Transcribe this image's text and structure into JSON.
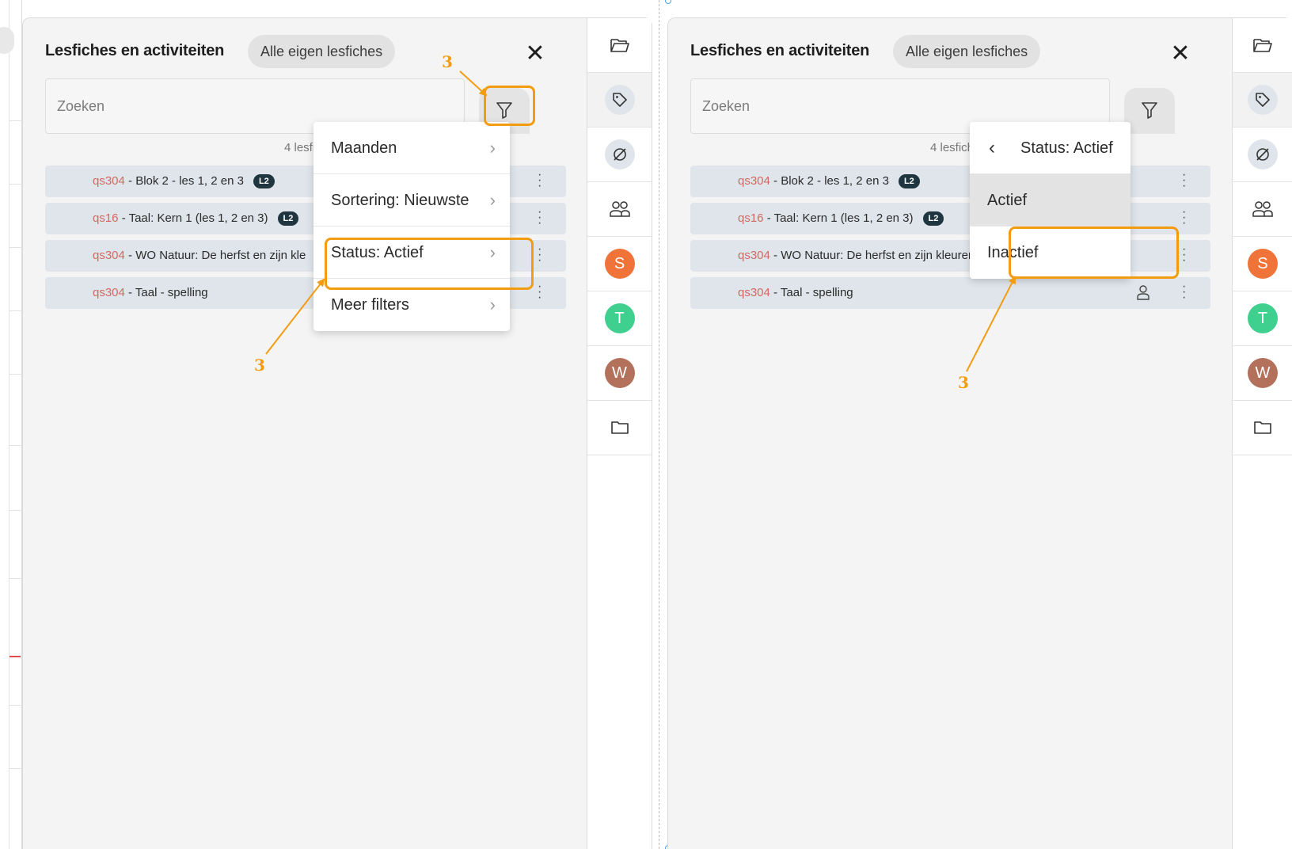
{
  "left": {
    "panel": {
      "title": "Lesfiches en activiteiten",
      "chip": "Alle eigen lesfiches",
      "search_placeholder": "Zoeken",
      "count": "4 lesfic"
    },
    "rows": [
      {
        "code": "qs304",
        "title": " - Blok 2 - les 1, 2 en 3",
        "badge": "L2"
      },
      {
        "code": "qs16",
        "title": " - Taal: Kern 1 (les 1, 2 en 3)",
        "badge": "L2"
      },
      {
        "code": "qs304",
        "title": " - WO Natuur: De herfst en zijn kle",
        "badge": ""
      },
      {
        "code": "qs304",
        "title": " - Taal - spelling",
        "badge": ""
      }
    ],
    "menu": [
      {
        "label": "Maanden"
      },
      {
        "label": "Sortering: Nieuwste"
      },
      {
        "label": "Status: Actief"
      },
      {
        "label": "Meer filters"
      }
    ],
    "annotations": [
      "3",
      "3"
    ]
  },
  "right": {
    "panel": {
      "title": "Lesfiches en activiteiten",
      "chip": "Alle eigen lesfiches",
      "search_placeholder": "Zoeken",
      "count": "4 lesfiches"
    },
    "rows": [
      {
        "code": "qs304",
        "title": " - Blok 2 - les 1, 2 en 3",
        "badge": "L2"
      },
      {
        "code": "qs16",
        "title": " - Taal: Kern 1 (les 1, 2 en 3)",
        "badge": "L2"
      },
      {
        "code": "qs304",
        "title": " - WO Natuur: De herfst en zijn kleuren d",
        "badge": ""
      },
      {
        "code": "qs304",
        "title": " - Taal - spelling",
        "badge": ""
      }
    ],
    "submenu": {
      "header": "Status: Actief",
      "options": [
        "Actief",
        "Inactief"
      ]
    },
    "annotations": [
      "3"
    ]
  },
  "sidebar": {
    "avatars": [
      {
        "letter": "S",
        "color": "#f0743a"
      },
      {
        "letter": "T",
        "color": "#3fcf8e"
      },
      {
        "letter": "W",
        "color": "#b3705a"
      }
    ]
  },
  "colors": {
    "highlight": "#f39c12",
    "code": "#d06a62",
    "badge": "#1f3540"
  }
}
